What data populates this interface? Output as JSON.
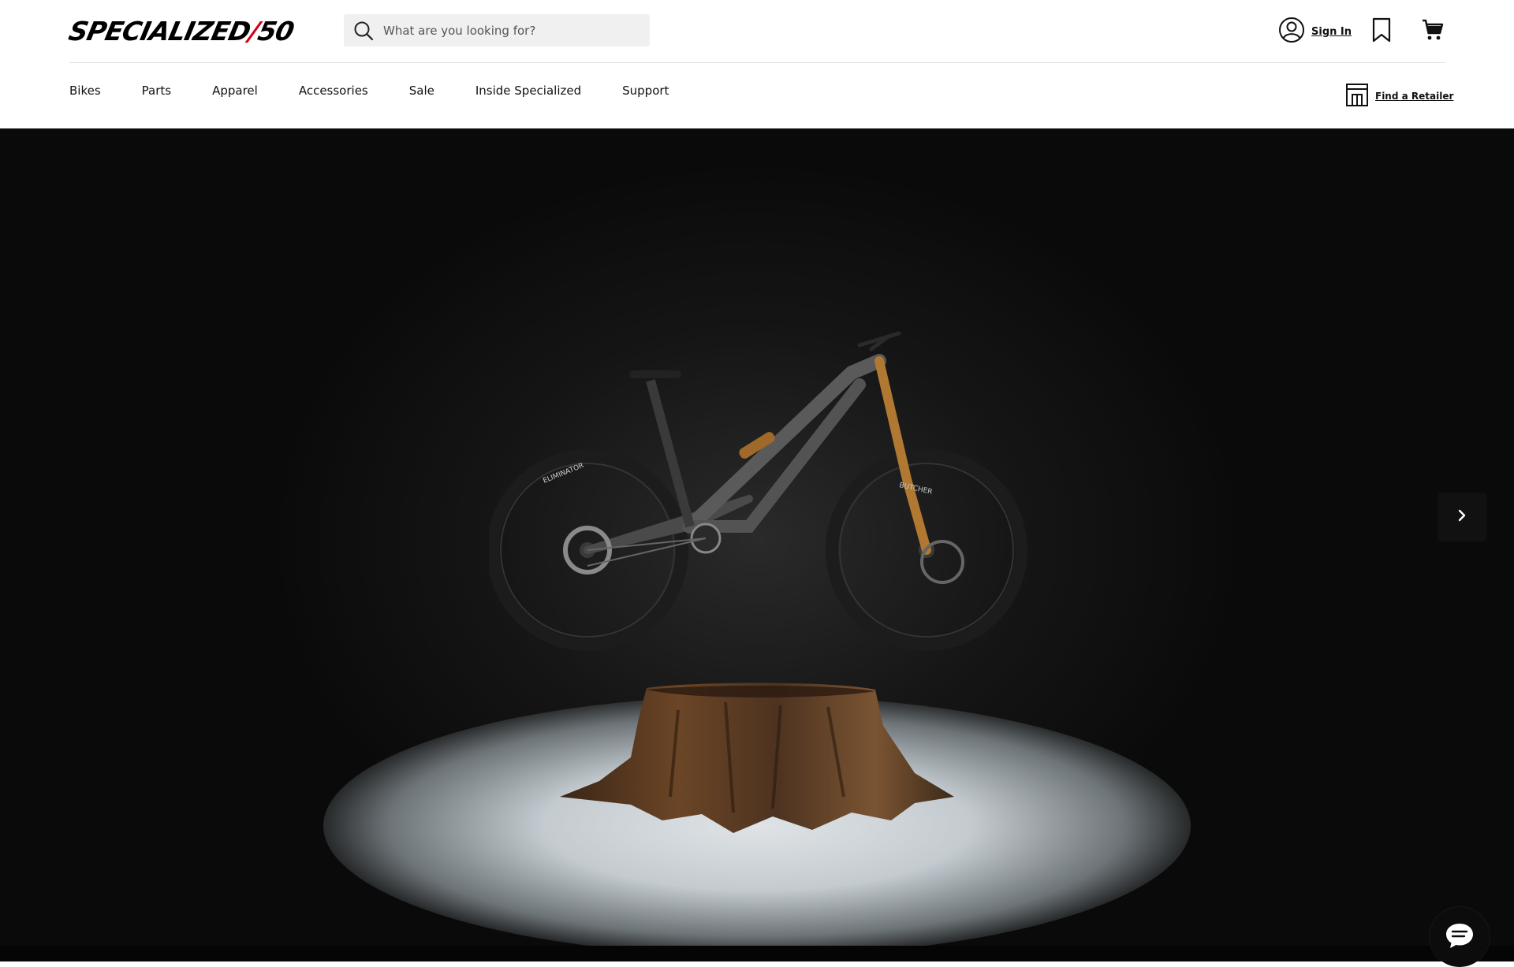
{
  "brand": {
    "logo_main": "SPECIALIZED",
    "logo_sep": "/",
    "logo_num": "50"
  },
  "search": {
    "placeholder": "What are you looking for?"
  },
  "account": {
    "sign_in_label": "Sign In"
  },
  "nav": {
    "items": [
      "Bikes",
      "Parts",
      "Apparel",
      "Accessories",
      "Sale",
      "Inside Specialized",
      "Support"
    ]
  },
  "retailer": {
    "label": "Find a Retailer"
  },
  "hero": {
    "tire_rear": "ELIMINATOR",
    "tire_front": "BUTCHER"
  },
  "icons": {
    "search": "search-icon",
    "user": "user-icon",
    "bookmark": "bookmark-icon",
    "cart": "cart-icon",
    "store": "store-icon",
    "next": "chevron-right-icon",
    "chat": "chat-icon"
  },
  "colors": {
    "brand_red": "#d0021b",
    "hero_background": "#111111",
    "search_background": "#f0f0f0"
  }
}
